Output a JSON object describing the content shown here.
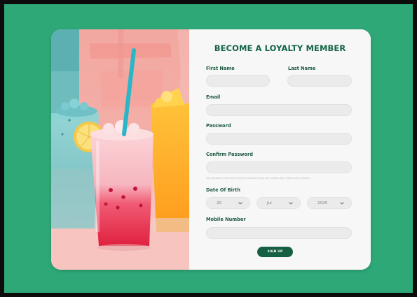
{
  "colors": {
    "page_background": "#2fa878",
    "card_background": "#f7f7f7",
    "accent_green": "#155f43",
    "title_green": "#156445",
    "input_background": "#ebebeb"
  },
  "hero": {
    "image": "colorful-drinks-icon"
  },
  "form": {
    "title": "BECOME A LOYALTY MEMBER",
    "first_name_label": "First Name",
    "last_name_label": "Last Name",
    "email_label": "Email",
    "password_label": "Password",
    "confirm_password_label": "Confirm Password",
    "password_helper": "The password must be at least 8 characters long and contain both letters and numbers",
    "dob_label": "Date Of Birth",
    "dob_day": "20",
    "dob_month": "Jul",
    "dob_year": "2025",
    "mobile_label": "Mobile Number",
    "signup_label": "SIGN UP"
  }
}
